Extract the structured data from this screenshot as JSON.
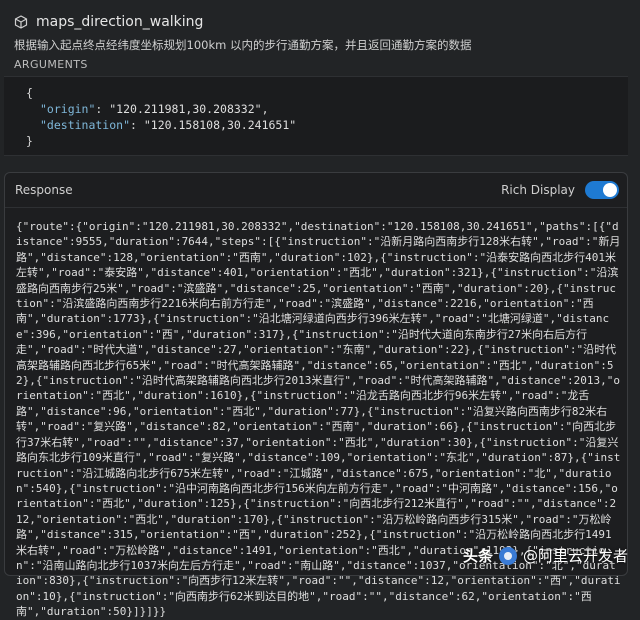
{
  "tool": {
    "icon": "cube-icon",
    "name": "maps_direction_walking",
    "description": "根据输入起点终点经纬度坐标规划100km 以内的步行通勤方案，并且返回通勤方案的数据"
  },
  "arguments": {
    "label": "ARGUMENTS",
    "open_brace": "{",
    "close_brace": "}",
    "origin_key": "\"origin\"",
    "origin_value": "\"120.211981,30.208332\"",
    "destination_key": "\"destination\"",
    "destination_value": "\"120.158108,30.241651\""
  },
  "response": {
    "label": "Response",
    "rich_display_label": "Rich Display",
    "rich_display_on": true,
    "body": "{\"route\":{\"origin\":\"120.211981,30.208332\",\"destination\":\"120.158108,30.241651\",\"paths\":[{\"distance\":9555,\"duration\":7644,\"steps\":[{\"instruction\":\"沿新月路向西南步行128米右转\",\"road\":\"新月路\",\"distance\":128,\"orientation\":\"西南\",\"duration\":102},{\"instruction\":\"沿泰安路向西北步行401米左转\",\"road\":\"泰安路\",\"distance\":401,\"orientation\":\"西北\",\"duration\":321},{\"instruction\":\"沿滨盛路向西南步行25米\",\"road\":\"滨盛路\",\"distance\":25,\"orientation\":\"西南\",\"duration\":20},{\"instruction\":\"沿滨盛路向西南步行2216米向右前方行走\",\"road\":\"滨盛路\",\"distance\":2216,\"orientation\":\"西南\",\"duration\":1773},{\"instruction\":\"沿北塘河绿道向西步行396米左转\",\"road\":\"北塘河绿道\",\"distance\":396,\"orientation\":\"西\",\"duration\":317},{\"instruction\":\"沿时代大道向东南步行27米向右后方行走\",\"road\":\"时代大道\",\"distance\":27,\"orientation\":\"东南\",\"duration\":22},{\"instruction\":\"沿时代高架路辅路向西北步行65米\",\"road\":\"时代高架路辅路\",\"distance\":65,\"orientation\":\"西北\",\"duration\":52},{\"instruction\":\"沿时代高架路辅路向西北步行2013米直行\",\"road\":\"时代高架路辅路\",\"distance\":2013,\"orientation\":\"西北\",\"duration\":1610},{\"instruction\":\"沿龙舌路向西北步行96米左转\",\"road\":\"龙舌路\",\"distance\":96,\"orientation\":\"西北\",\"duration\":77},{\"instruction\":\"沿复兴路向西南步行82米右转\",\"road\":\"复兴路\",\"distance\":82,\"orientation\":\"西南\",\"duration\":66},{\"instruction\":\"向西北步行37米右转\",\"road\":\"\",\"distance\":37,\"orientation\":\"西北\",\"duration\":30},{\"instruction\":\"沿复兴路向东北步行109米直行\",\"road\":\"复兴路\",\"distance\":109,\"orientation\":\"东北\",\"duration\":87},{\"instruction\":\"沿江城路向北步行675米左转\",\"road\":\"江城路\",\"distance\":675,\"orientation\":\"北\",\"duration\":540},{\"instruction\":\"沿中河南路向西北步行156米向左前方行走\",\"road\":\"中河南路\",\"distance\":156,\"orientation\":\"西北\",\"duration\":125},{\"instruction\":\"向西北步行212米直行\",\"road\":\"\",\"distance\":212,\"orientation\":\"西北\",\"duration\":170},{\"instruction\":\"沿万松岭路向西步行315米\",\"road\":\"万松岭路\",\"distance\":315,\"orientation\":\"西\",\"duration\":252},{\"instruction\":\"沿万松岭路向西北步行1491米右转\",\"road\":\"万松岭路\",\"distance\":1491,\"orientation\":\"西北\",\"duration\":1193},{\"instruction\":\"沿南山路向北步行1037米向左后方行走\",\"road\":\"南山路\",\"distance\":1037,\"orientation\":\"北\",\"duration\":830},{\"instruction\":\"向西步行12米左转\",\"road\":\"\",\"distance\":12,\"orientation\":\"西\",\"duration\":10},{\"instruction\":\"向西南步行62米到达目的地\",\"road\":\"\",\"distance\":62,\"orientation\":\"西南\",\"duration\":50}]}]}}"
  },
  "watermark": {
    "brand": "头条",
    "handle": "@阿里云开发者"
  },
  "colors": {
    "background": "#222426",
    "panel": "#1d1e20",
    "toggle_on": "#1e7ad2",
    "json_key": "#7fb7d9"
  }
}
